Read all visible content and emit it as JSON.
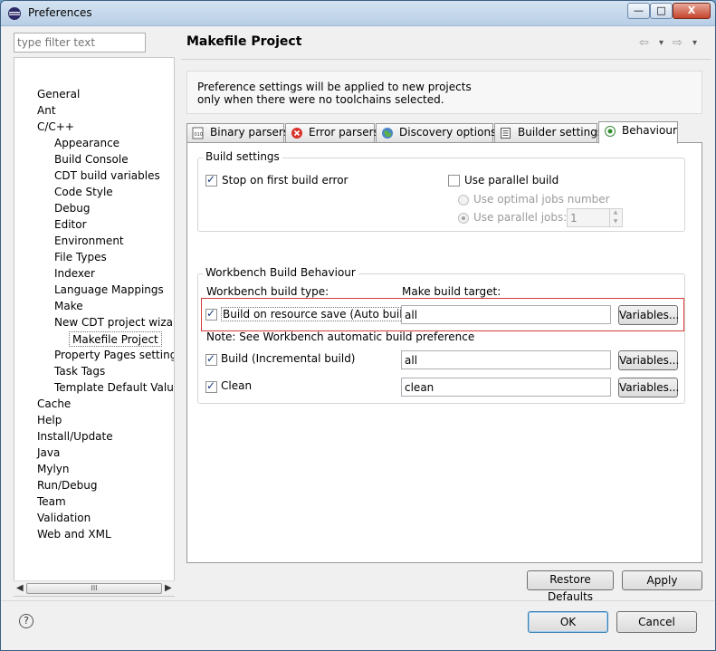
{
  "window": {
    "title": "Preferences",
    "controls": {
      "minimize": "—",
      "maximize": "□",
      "close": "X"
    }
  },
  "filter": {
    "placeholder": "type filter text"
  },
  "tree": [
    {
      "label": "General",
      "level": 0
    },
    {
      "label": "Ant",
      "level": 0
    },
    {
      "label": "C/C++",
      "level": 0
    },
    {
      "label": "Appearance",
      "level": 1
    },
    {
      "label": "Build Console",
      "level": 1
    },
    {
      "label": "CDT build variables",
      "level": 1
    },
    {
      "label": "Code Style",
      "level": 1
    },
    {
      "label": "Debug",
      "level": 1
    },
    {
      "label": "Editor",
      "level": 1
    },
    {
      "label": "Environment",
      "level": 1
    },
    {
      "label": "File Types",
      "level": 1
    },
    {
      "label": "Indexer",
      "level": 1
    },
    {
      "label": "Language Mappings",
      "level": 1
    },
    {
      "label": "Make",
      "level": 1
    },
    {
      "label": "New CDT project wizard",
      "level": 1
    },
    {
      "label": "Makefile Project",
      "level": 2,
      "selected": true
    },
    {
      "label": "Property Pages settings",
      "level": 1
    },
    {
      "label": "Task Tags",
      "level": 1
    },
    {
      "label": "Template Default Values",
      "level": 1
    },
    {
      "label": "Cache",
      "level": 0
    },
    {
      "label": "Help",
      "level": 0
    },
    {
      "label": "Install/Update",
      "level": 0
    },
    {
      "label": "Java",
      "level": 0
    },
    {
      "label": "Mylyn",
      "level": 0
    },
    {
      "label": "Run/Debug",
      "level": 0
    },
    {
      "label": "Team",
      "level": 0
    },
    {
      "label": "Validation",
      "level": 0
    },
    {
      "label": "Web and XML",
      "level": 0
    }
  ],
  "page": {
    "title": "Makefile Project",
    "nav": {
      "back": "⇦",
      "back_menu": "▾",
      "forward": "⇨",
      "forward_menu": "▾"
    },
    "info_line1": "Preference settings will be applied to new projects",
    "info_line2": "only when there were no toolchains selected."
  },
  "tabs": [
    {
      "label": "Binary parsers",
      "icon": "binary-icon"
    },
    {
      "label": "Error parsers",
      "icon": "error-icon"
    },
    {
      "label": "Discovery options",
      "icon": "globe-icon"
    },
    {
      "label": "Builder settings",
      "icon": "list-icon"
    },
    {
      "label": "Behaviour",
      "icon": "radio-icon",
      "active": true
    }
  ],
  "build_settings": {
    "title": "Build settings",
    "stop_on_error": {
      "label": "Stop on first build error",
      "checked": true
    },
    "parallel_build": {
      "label": "Use parallel build",
      "checked": false
    },
    "optimal_jobs": {
      "label": "Use optimal jobs number",
      "selected": false
    },
    "parallel_jobs": {
      "label": "Use parallel jobs:",
      "selected": true,
      "value": "1"
    }
  },
  "workbench": {
    "title": "Workbench Build Behaviour",
    "build_type_header": "Workbench build type:",
    "target_header": "Make build target:",
    "auto_build": {
      "label": "Build on resource save (Auto build)",
      "checked": true,
      "target": "all"
    },
    "note": "Note: See Workbench automatic build preference",
    "incremental": {
      "label": "Build (Incremental build)",
      "checked": true,
      "target": "all"
    },
    "clean": {
      "label": "Clean",
      "checked": true,
      "target": "clean"
    },
    "variables_label": "Variables..."
  },
  "buttons": {
    "restore_defaults": "Restore Defaults",
    "apply": "Apply",
    "ok": "OK",
    "cancel": "Cancel",
    "help": "?"
  },
  "scroll": {
    "left": "◀",
    "right": "▶",
    "grip": "III"
  }
}
